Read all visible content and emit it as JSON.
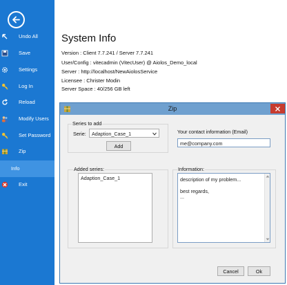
{
  "sidebar": {
    "items": [
      {
        "label": "Undo All",
        "icon": "undo-icon"
      },
      {
        "label": "Save",
        "icon": "save-icon"
      },
      {
        "label": "Settings",
        "icon": "gear-icon"
      },
      {
        "label": "Log In",
        "icon": "key-icon"
      },
      {
        "label": "Reload",
        "icon": "reload-icon"
      },
      {
        "label": "Modify Users",
        "icon": "users-icon"
      },
      {
        "label": "Set Password",
        "icon": "key-icon"
      },
      {
        "label": "Zip",
        "icon": "zip-icon"
      },
      {
        "label": "Info",
        "icon": ""
      },
      {
        "label": "Exit",
        "icon": "exit-icon"
      }
    ],
    "active_item": "Info",
    "background": "#1b78d2",
    "active_background": "#3f93e2"
  },
  "main": {
    "title": "System Info",
    "lines": [
      "Version : Client 7.7.241 / Server 7.7.241",
      "User/Config : vitecadmin (VitecUser) @ Aiolos_Demo_local",
      "Server : http://localhost/NewAiolosService",
      "Licensee : Christer Modin",
      "Server Space : 40/256 GB left"
    ]
  },
  "dialog": {
    "title": "Zip",
    "series_to_add_label": "Series to add",
    "serie_label": "Serie:",
    "serie_value": "Adaption_Case_1",
    "add_button": "Add",
    "contact_label": "Your contact information (Email)",
    "email_value": "me@company.com",
    "added_series_label": "Added series:",
    "added_series": [
      "Adaption_Case_1"
    ],
    "information_label": "Information:",
    "information_lines": [
      "description of my problem...",
      "",
      "best regards,",
      "..."
    ],
    "cancel_button": "Cancel",
    "ok_button": "Ok",
    "titlebar_color": "#6fa0cf",
    "close_color": "#c73b2e"
  }
}
